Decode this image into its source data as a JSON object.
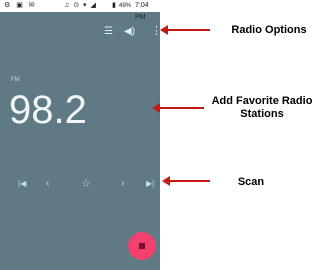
{
  "status_bar": {
    "left_icons": "⚙ ▣ ✉",
    "mid_icons": "♫ ⊙ ▾ ◢",
    "battery_icon": "battery-icon",
    "battery_percent": "49%",
    "time": "7:04 PM"
  },
  "toolbar": {
    "list_icon": "list-icon",
    "volume_icon": "volume-icon",
    "more_icon": "more-vert-icon"
  },
  "radio": {
    "band": "FM",
    "frequency": "98.2"
  },
  "controls": {
    "skip_previous": "skip-previous-icon",
    "previous": "chevron-left-icon",
    "favorite": "star-outline-icon",
    "next": "chevron-right-icon",
    "skip_next": "skip-next-icon"
  },
  "fab": {
    "icon": "stop-icon",
    "color": "#f2416e"
  },
  "callouts": {
    "radio_options": "Radio Options",
    "add_favorite": "Add Favorite Radio Stations",
    "scan": "Scan",
    "arrow_color": "#c41a12"
  },
  "colors": {
    "screen_bg": "#5f7a85",
    "text_light": "#f2f5f6"
  }
}
